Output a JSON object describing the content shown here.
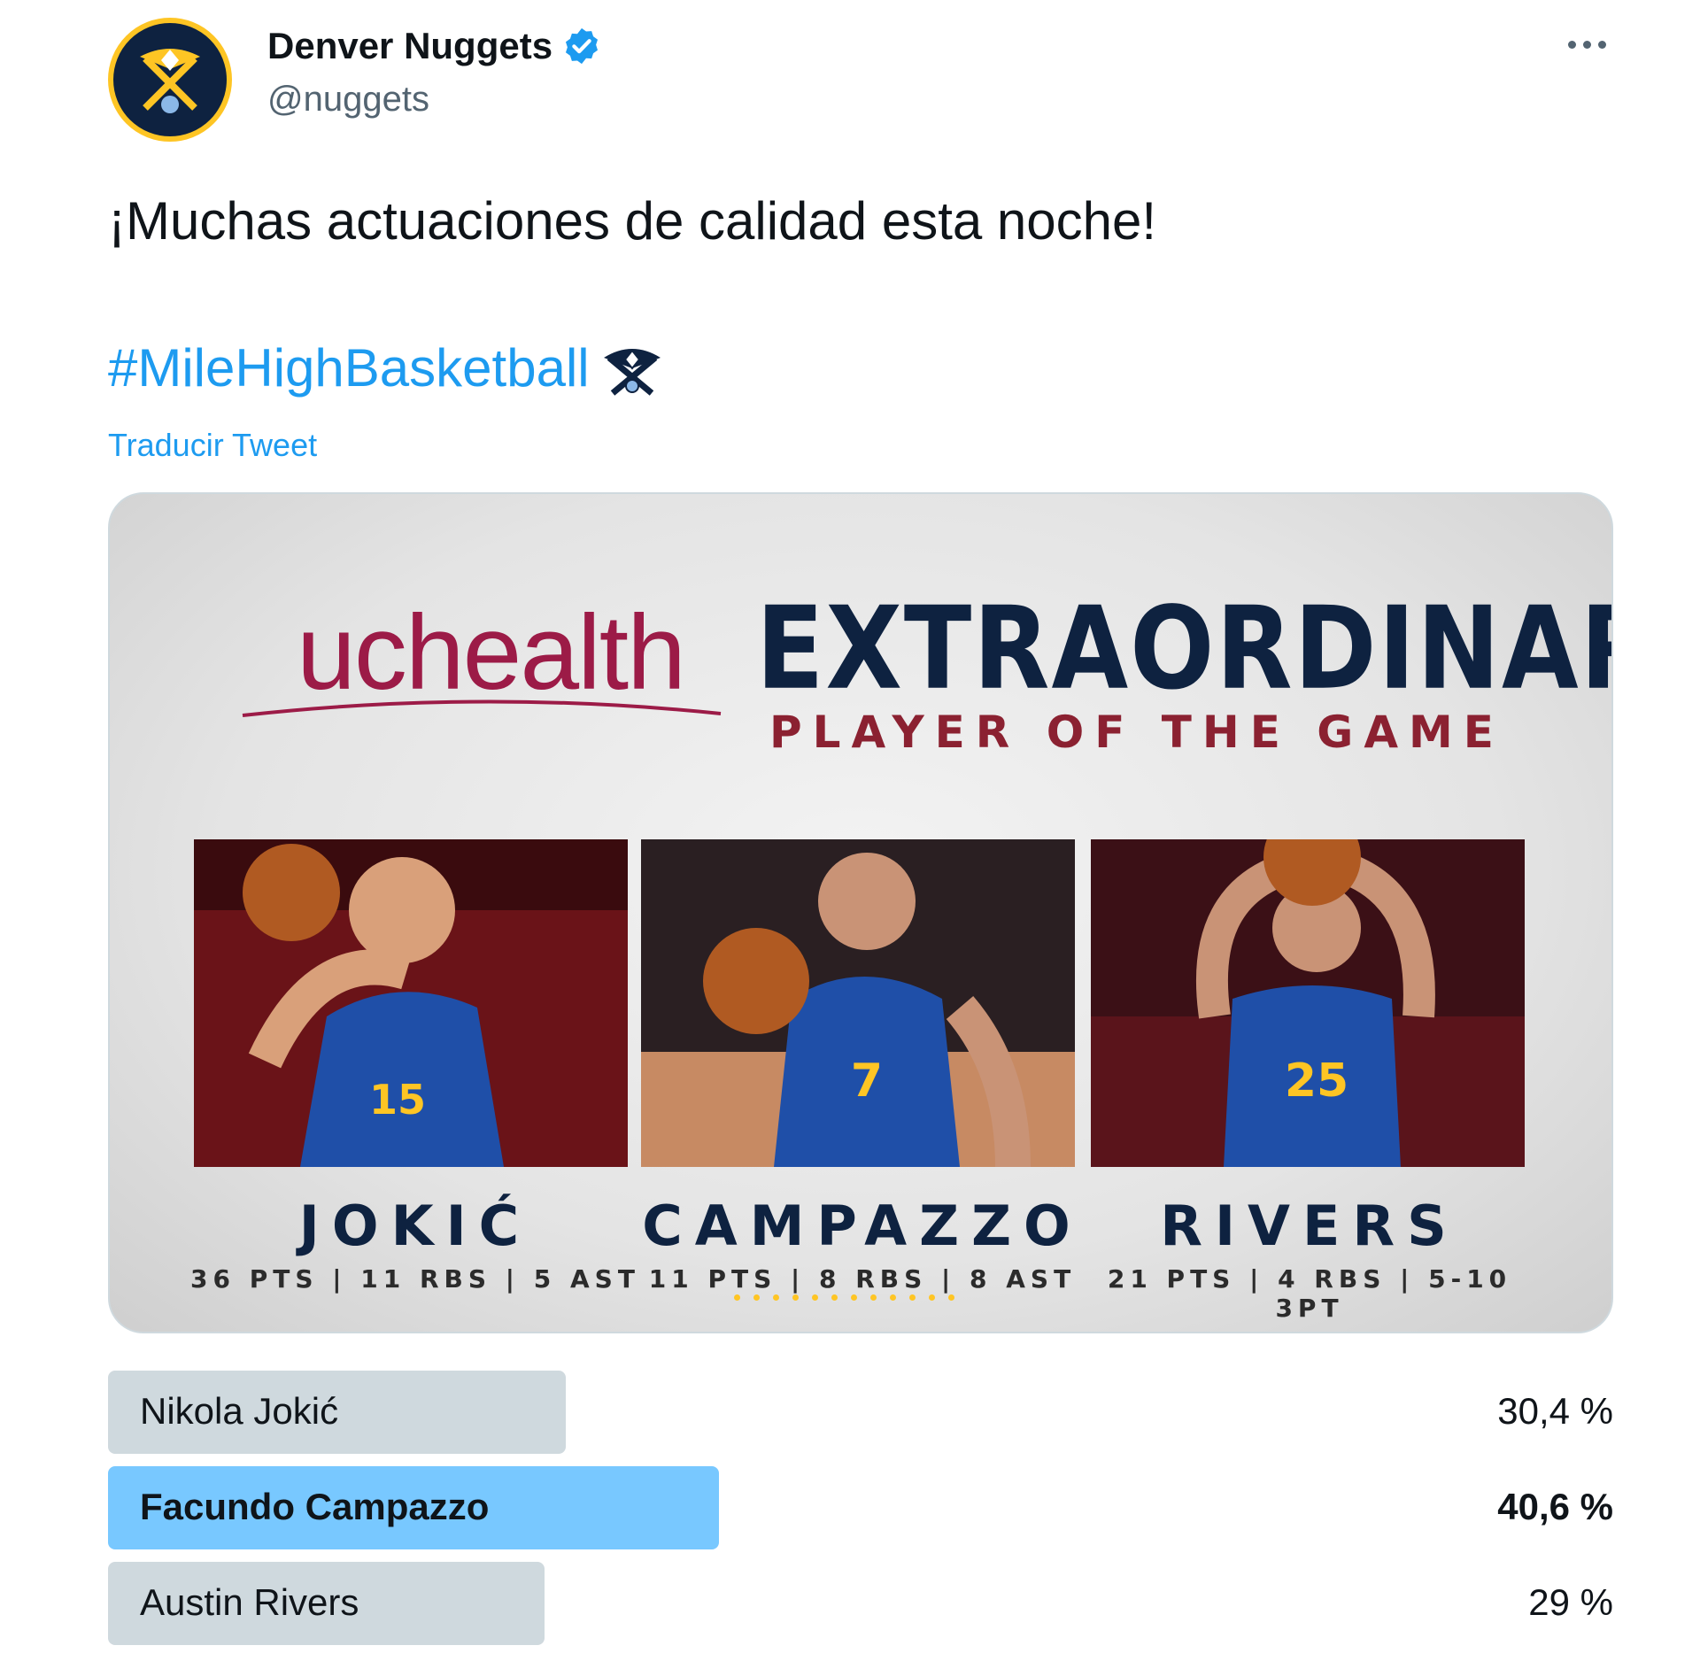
{
  "author": {
    "display_name": "Denver Nuggets",
    "handle": "@nuggets",
    "avatar_icon": "nuggets-logo-icon",
    "verified_icon": "verified-badge-icon"
  },
  "tweet": {
    "text": "¡Muchas actuaciones de calidad esta noche!",
    "hashtag": "#MileHighBasketball",
    "hashtag_emoji": "nuggets-pickaxe-emoji-icon",
    "translate_label": "Traducir Tweet"
  },
  "media": {
    "sponsor": "uchealth",
    "title": "EXTRAORDINARY",
    "subtitle": "PLAYER OF THE GAME",
    "players": [
      {
        "name": "JOKIĆ",
        "stats": "36 PTS | 11 RBS | 5 AST",
        "jersey": "15"
      },
      {
        "name": "CAMPAZZO",
        "stats": "11 PTS | 8 RBS | 8 AST",
        "jersey": "7"
      },
      {
        "name": "RIVERS",
        "stats": "21 PTS | 4 RBS | 5-10 3PT",
        "jersey": "25"
      }
    ]
  },
  "poll": {
    "options": [
      {
        "label": "Nikola Jokić",
        "percent_text": "30,4 %",
        "value": 30.4,
        "winner": false
      },
      {
        "label": "Facundo Campazzo",
        "percent_text": "40,6 %",
        "value": 40.6,
        "winner": true
      },
      {
        "label": "Austin Rivers",
        "percent_text": "29 %",
        "value": 29,
        "winner": false
      }
    ]
  },
  "colors": {
    "link": "#1d9bf0",
    "poll_bar": "#cfd9de",
    "poll_winner": "#78c8ff",
    "navy": "#0e2240",
    "gold": "#fec524",
    "maroon": "#8b2131"
  }
}
